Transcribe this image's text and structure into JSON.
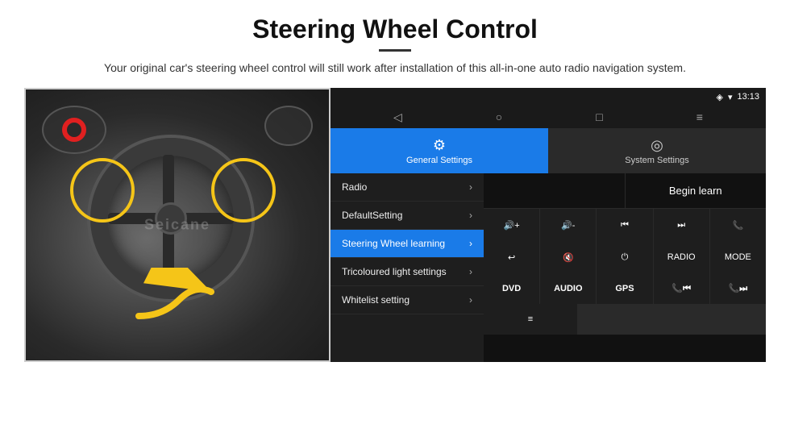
{
  "page": {
    "title": "Steering Wheel Control",
    "subtitle": "Your original car's steering wheel control will still work after installation of this all-in-one auto radio navigation system."
  },
  "statusBar": {
    "time": "13:13",
    "gpsIcon": "◈",
    "wifiIcon": "▾",
    "signalIcon": "◀"
  },
  "navBar": {
    "back": "◁",
    "home": "○",
    "recent": "□",
    "menu": "≡"
  },
  "tabs": {
    "general": {
      "label": "General Settings",
      "icon": "⚙"
    },
    "system": {
      "label": "System Settings",
      "icon": "◎"
    }
  },
  "menuItems": [
    {
      "label": "Radio",
      "active": false
    },
    {
      "label": "DefaultSetting",
      "active": false
    },
    {
      "label": "Steering Wheel learning",
      "active": true
    },
    {
      "label": "Tricoloured light settings",
      "active": false
    },
    {
      "label": "Whitelist setting",
      "active": false
    }
  ],
  "beginLearnBtn": "Begin learn",
  "ctrlButtons": {
    "row1": [
      {
        "label": "🔊+",
        "icon": true
      },
      {
        "label": "🔊-",
        "icon": true
      },
      {
        "label": "⏮",
        "icon": true
      },
      {
        "label": "⏭",
        "icon": true
      },
      {
        "label": "📞",
        "icon": true
      }
    ],
    "row2": [
      {
        "label": "↩",
        "icon": true
      },
      {
        "label": "🔇",
        "icon": true
      },
      {
        "label": "⏻",
        "icon": true
      },
      {
        "label": "RADIO",
        "icon": false
      },
      {
        "label": "MODE",
        "icon": false
      }
    ],
    "row3": [
      {
        "label": "DVD",
        "icon": false
      },
      {
        "label": "AUDIO",
        "icon": false
      },
      {
        "label": "GPS",
        "icon": false
      },
      {
        "label": "📞⏮",
        "icon": true
      },
      {
        "label": "📞⏭",
        "icon": true
      }
    ],
    "row4": [
      {
        "label": "≡",
        "icon": true
      }
    ]
  }
}
